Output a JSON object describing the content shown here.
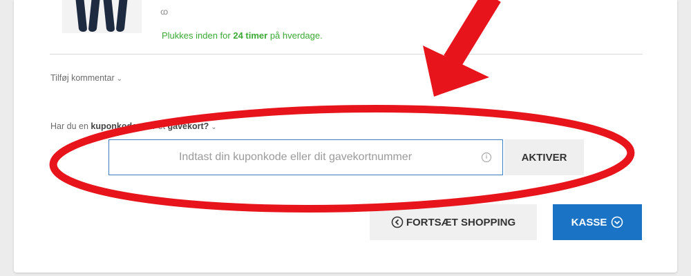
{
  "product": {
    "stock_note_prefix": "Plukkes inden for ",
    "stock_note_bold": "24 timer",
    "stock_note_suffix": " på hverdage.",
    "stock_glyph": "ꭃ"
  },
  "comment": {
    "toggle_label": "Tilføj kommentar"
  },
  "coupon": {
    "question_prefix": "Har du en ",
    "question_bold_1": "kuponkode",
    "question_middle": " eller et ",
    "question_bold_2": "gavekort?",
    "placeholder": "Indtast din kuponkode eller dit gavekortnummer",
    "info_glyph": "i",
    "activate_label": "AKTIVER"
  },
  "actions": {
    "continue_label": "FORTSÆT SHOPPING",
    "checkout_label": "KASSE"
  },
  "colors": {
    "accent_blue": "#1a73c5",
    "in_stock_green": "#3aaa35",
    "annotation_red": "#e8141c"
  },
  "icons": {
    "continue": "chevron-left-circle-icon",
    "checkout": "chevron-down-circle-icon",
    "info": "info-icon"
  }
}
